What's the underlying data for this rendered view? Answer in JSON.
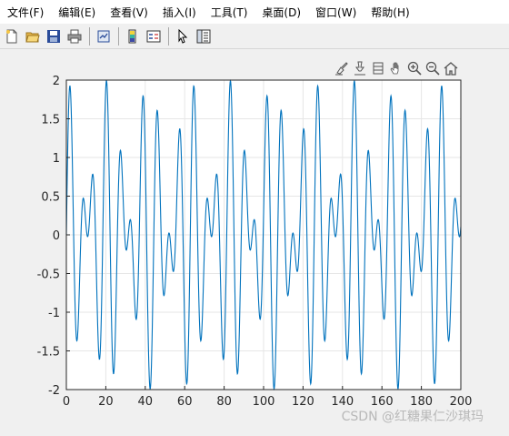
{
  "menubar": {
    "items": [
      "文件(F)",
      "编辑(E)",
      "查看(V)",
      "插入(I)",
      "工具(T)",
      "桌面(D)",
      "窗口(W)",
      "帮助(H)"
    ]
  },
  "toolbar": {
    "buttons": [
      "new-figure-icon",
      "open-file-icon",
      "save-icon",
      "print-icon",
      "link-plot-icon",
      "insert-colorbar-icon",
      "insert-legend-icon",
      "edit-plot-icon",
      "property-inspector-icon"
    ]
  },
  "axes_toolbar": {
    "buttons": [
      "brush-icon",
      "data-tips-icon",
      "rotate-icon",
      "pan-icon",
      "zoom-in-icon",
      "zoom-out-icon",
      "home-icon"
    ]
  },
  "watermark": "CSDN @红糖果仁沙琪玛",
  "colors": {
    "line": "#0072bd",
    "grid": "#e6e6e6",
    "axes_bg": "#ffffff",
    "figure_bg": "#f0f0f0"
  },
  "chart_data": {
    "type": "line",
    "title": "",
    "xlabel": "",
    "ylabel": "",
    "xlim": [
      0,
      200
    ],
    "ylim": [
      -2,
      2
    ],
    "xticks": [
      0,
      20,
      40,
      60,
      80,
      100,
      120,
      140,
      160,
      180,
      200
    ],
    "yticks": [
      2,
      1.5,
      1,
      0.5,
      0,
      -0.5,
      -1,
      -1.5,
      -2
    ],
    "ytick_labels": [
      "2",
      "1.5",
      "1",
      "0.5",
      "0",
      "-0.5",
      "-1",
      "-1.5",
      "-2"
    ],
    "grid": true,
    "series": [
      {
        "function": "y = sin(0.7x) + sin(1.0x)",
        "x_range": [
          0,
          200
        ],
        "samples": 1400
      }
    ]
  }
}
